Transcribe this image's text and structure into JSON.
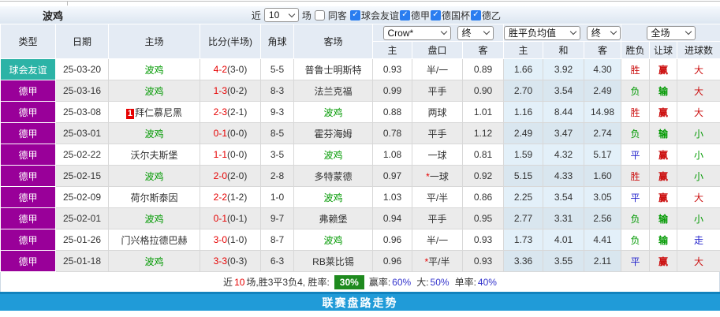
{
  "colors": {
    "red": "#cc1111",
    "green": "#009900",
    "blue": "#2222cc",
    "score_red": "#e60000",
    "self": "#009900",
    "type_teal": "#2cb3a6",
    "type_purple": "#990099",
    "rate_green": "#1e8a1e",
    "bar_blue": "#209bd8",
    "check_blue": "#2a7df0",
    "percent_blue": "#3333cc"
  },
  "page": {
    "title": "波鸡",
    "filters": {
      "recent_label": "近",
      "recent_value": "10",
      "matches_label": "场",
      "same_venue_label": "同客",
      "competitions": [
        {
          "label": "球会友谊",
          "checked": true
        },
        {
          "label": "德甲",
          "checked": true
        },
        {
          "label": "德国杯",
          "checked": true
        },
        {
          "label": "德乙",
          "checked": true
        }
      ]
    }
  },
  "table": {
    "headers": {
      "type": "类型",
      "date": "日期",
      "home": "主场",
      "score": "比分(半场)",
      "corner": "角球",
      "away": "客场",
      "odds_group_select": "Crow*",
      "odds_final_select": "终",
      "odds_sub_home": "主",
      "odds_sub_handicap": "盘口",
      "odds_sub_away": "客",
      "avg_group_select": "胜平负均值",
      "avg_final_select": "终",
      "avg_sub_home": "主",
      "avg_sub_draw": "和",
      "avg_sub_away": "客",
      "result_group_select": "全场",
      "result_sub_wdl": "胜负",
      "result_sub_handicap": "让球",
      "result_sub_goals": "进球数"
    },
    "rows": [
      {
        "type": "球会友谊",
        "type_color": "type_teal",
        "date": "25-03-20",
        "home": "波鸡",
        "home_self": true,
        "away": "普鲁士明斯特",
        "away_self": false,
        "ft": "4-2",
        "ht": "3-0",
        "corner": "5-5",
        "o1": "0.93",
        "hc": "半/一",
        "star": false,
        "o2": "0.89",
        "a1": "1.66",
        "a2": "3.92",
        "a3": "4.30",
        "wdl": [
          "胜",
          "red"
        ],
        "hr": [
          "赢",
          "red"
        ],
        "gl": [
          "大",
          "red"
        ]
      },
      {
        "type": "德甲",
        "type_color": "type_purple",
        "date": "25-03-16",
        "home": "波鸡",
        "home_self": true,
        "away": "法兰克福",
        "away_self": false,
        "ft": "1-3",
        "ht": "0-2",
        "corner": "8-3",
        "o1": "0.99",
        "hc": "平手",
        "star": false,
        "o2": "0.90",
        "a1": "2.70",
        "a2": "3.54",
        "a3": "2.49",
        "wdl": [
          "负",
          "green"
        ],
        "hr": [
          "输",
          "green"
        ],
        "gl": [
          "大",
          "red"
        ]
      },
      {
        "type": "德甲",
        "type_color": "type_purple",
        "date": "25-03-08",
        "home": "拜仁慕尼黑",
        "home_self": false,
        "home_rank": "1",
        "away": "波鸡",
        "away_self": true,
        "ft": "2-3",
        "ht": "2-1",
        "corner": "9-3",
        "o1": "0.88",
        "hc": "两球",
        "star": false,
        "o2": "1.01",
        "a1": "1.16",
        "a2": "8.44",
        "a3": "14.98",
        "wdl": [
          "胜",
          "red"
        ],
        "hr": [
          "赢",
          "red"
        ],
        "gl": [
          "大",
          "red"
        ]
      },
      {
        "type": "德甲",
        "type_color": "type_purple",
        "date": "25-03-01",
        "home": "波鸡",
        "home_self": true,
        "away": "霍芬海姆",
        "away_self": false,
        "ft": "0-1",
        "ht": "0-0",
        "corner": "8-5",
        "o1": "0.78",
        "hc": "平手",
        "star": false,
        "o2": "1.12",
        "a1": "2.49",
        "a2": "3.47",
        "a3": "2.74",
        "wdl": [
          "负",
          "green"
        ],
        "hr": [
          "输",
          "green"
        ],
        "gl": [
          "小",
          "green"
        ]
      },
      {
        "type": "德甲",
        "type_color": "type_purple",
        "date": "25-02-22",
        "home": "沃尔夫斯堡",
        "home_self": false,
        "away": "波鸡",
        "away_self": true,
        "ft": "1-1",
        "ht": "0-0",
        "corner": "3-5",
        "o1": "1.08",
        "hc": "一球",
        "star": false,
        "o2": "0.81",
        "a1": "1.59",
        "a2": "4.32",
        "a3": "5.17",
        "wdl": [
          "平",
          "blue"
        ],
        "hr": [
          "赢",
          "red"
        ],
        "gl": [
          "小",
          "green"
        ]
      },
      {
        "type": "德甲",
        "type_color": "type_purple",
        "date": "25-02-15",
        "home": "波鸡",
        "home_self": true,
        "away": "多特蒙德",
        "away_self": false,
        "ft": "2-0",
        "ht": "2-0",
        "corner": "2-8",
        "o1": "0.97",
        "hc": "一球",
        "star": true,
        "o2": "0.92",
        "a1": "5.15",
        "a2": "4.33",
        "a3": "1.60",
        "wdl": [
          "胜",
          "red"
        ],
        "hr": [
          "赢",
          "red"
        ],
        "gl": [
          "小",
          "green"
        ]
      },
      {
        "type": "德甲",
        "type_color": "type_purple",
        "date": "25-02-09",
        "home": "荷尔斯泰因",
        "home_self": false,
        "away": "波鸡",
        "away_self": true,
        "ft": "2-2",
        "ht": "1-2",
        "corner": "1-0",
        "o1": "1.03",
        "hc": "平/半",
        "star": false,
        "o2": "0.86",
        "a1": "2.25",
        "a2": "3.54",
        "a3": "3.05",
        "wdl": [
          "平",
          "blue"
        ],
        "hr": [
          "赢",
          "red"
        ],
        "gl": [
          "大",
          "red"
        ]
      },
      {
        "type": "德甲",
        "type_color": "type_purple",
        "date": "25-02-01",
        "home": "波鸡",
        "home_self": true,
        "away": "弗赖堡",
        "away_self": false,
        "ft": "0-1",
        "ht": "0-1",
        "corner": "9-7",
        "o1": "0.94",
        "hc": "平手",
        "star": false,
        "o2": "0.95",
        "a1": "2.77",
        "a2": "3.31",
        "a3": "2.56",
        "wdl": [
          "负",
          "green"
        ],
        "hr": [
          "输",
          "green"
        ],
        "gl": [
          "小",
          "green"
        ]
      },
      {
        "type": "德甲",
        "type_color": "type_purple",
        "date": "25-01-26",
        "home": "门兴格拉德巴赫",
        "home_self": false,
        "away": "波鸡",
        "away_self": true,
        "ft": "3-0",
        "ht": "1-0",
        "corner": "8-7",
        "o1": "0.96",
        "hc": "半/一",
        "star": false,
        "o2": "0.93",
        "a1": "1.73",
        "a2": "4.01",
        "a3": "4.41",
        "wdl": [
          "负",
          "green"
        ],
        "hr": [
          "输",
          "green"
        ],
        "gl": [
          "走",
          "blue"
        ]
      },
      {
        "type": "德甲",
        "type_color": "type_purple",
        "date": "25-01-18",
        "home": "波鸡",
        "home_self": true,
        "away": "RB莱比锡",
        "away_self": false,
        "ft": "3-3",
        "ht": "0-3",
        "corner": "6-3",
        "o1": "0.96",
        "hc": "平/半",
        "star": true,
        "o2": "0.93",
        "a1": "3.36",
        "a2": "3.55",
        "a3": "2.11",
        "wdl": [
          "平",
          "blue"
        ],
        "hr": [
          "赢",
          "red"
        ],
        "gl": [
          "大",
          "red"
        ]
      }
    ]
  },
  "summary": {
    "near": "近",
    "count": "10",
    "mid": "场,胜3平3负4, 胜率:",
    "rate": "30%",
    "win_label": "赢率:",
    "win": "60%",
    "big_label": "大:",
    "big": "50%",
    "single_label": "单率:",
    "single": "40%"
  },
  "footer": {
    "title": "联赛盘路走势"
  }
}
